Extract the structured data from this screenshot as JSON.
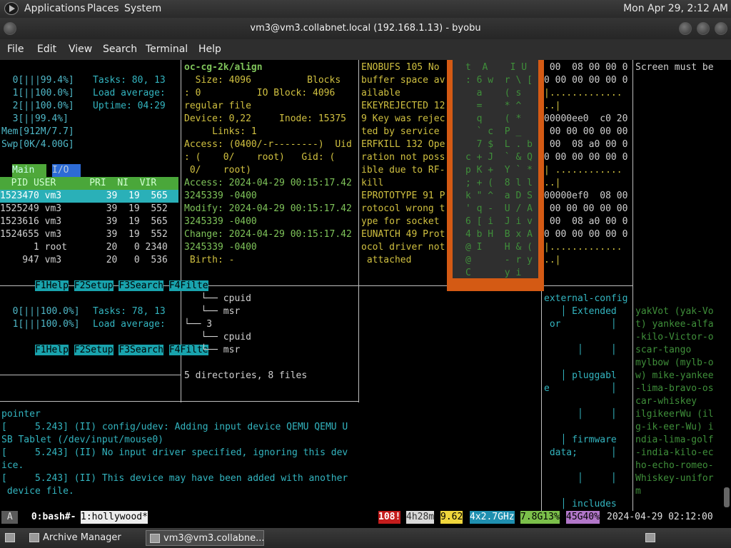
{
  "top_panel": {
    "menus": [
      "Applications",
      "Places",
      "System"
    ],
    "clock": "Mon Apr 29,  2:12 AM"
  },
  "window": {
    "title": "vm3@vm3.collabnet.local (192.168.1.13) - byobu"
  },
  "menubar": [
    "File",
    "Edit",
    "View",
    "Search",
    "Terminal",
    "Help"
  ],
  "htop_top": {
    "cpu_lines": [
      "  0[|||99.4%]",
      "  1[||100.0%]",
      "  2[||100.0%]",
      "  3[||99.4%]",
      "Mem[912M/7.7]",
      "Swp[0K/4.00G]"
    ],
    "tasks": "Tasks: 80, 13",
    "load": "Load average:",
    "uptime": "Uptime: 04:29",
    "tabs": [
      "Main",
      "I/O"
    ],
    "header": "  PID USER      PRI  NI  VIR",
    "rows": [
      "1523470 vm3        39  19  565",
      "1525249 vm3        39  19  552",
      "1523616 vm3        39  19  565",
      "1524655 vm3        39  19  552",
      "      1 root       20   0 2340",
      "    947 vm3        20   0  536"
    ],
    "fkeys": [
      "F1Help",
      "F2Setup",
      "F3Search",
      "F4Filte"
    ]
  },
  "htop_bottom": {
    "cpu_lines": [
      "  0[|||100.0%]",
      "  1[|||100.0%]"
    ],
    "tasks": "Tasks: 78, 13",
    "load": "Load average:",
    "fkeys": [
      "F1Help",
      "F2Setup",
      "F3Search",
      "F4Filte"
    ]
  },
  "stat": {
    "lines": [
      "oc-cg-2k/align",
      "  Size: 4096          Blocks",
      ": 0          IO Block: 4096",
      "regular file",
      "Device: 0,22     Inode: 15375",
      "     Links: 1",
      "Access: (0400/-r--------)  Uid",
      ": (    0/    root)   Gid: (",
      " 0/    root)",
      "Access: 2024-04-29 00:15:17.42",
      "3245339 -0400",
      "Modify: 2024-04-29 00:15:17.42",
      "3245339 -0400",
      "Change: 2024-04-29 00:15:17.42",
      "3245339 -0400",
      " Birth: -"
    ]
  },
  "errno": {
    "lines": [
      "ENOBUFS 105 No",
      "buffer space av",
      "ailable",
      "EKEYREJECTED 12",
      "9 Key was rejec",
      "ted by service",
      "ERFKILL 132 Ope",
      "ration not poss",
      "ible due to RF-",
      "kill",
      "EPROTOTYPE 91 P",
      "rotocol wrong t",
      "ype for socket",
      "EUNATCH 49 Prot",
      "ocol driver not",
      " attached"
    ]
  },
  "popup": {
    "lines": [
      "t  A    I U",
      ": 6 w  r \\ [",
      "  a    ( s",
      "  =    * ^",
      "  q    ( *",
      "  ` c  P _",
      "  7 $  L . b",
      "c + J  ` & Q",
      "p K +  Y ` *",
      "; + (  8 l l",
      "k \" ^  a D S",
      "' q -  U / A",
      "6 [ i  J i v",
      "4 b H  B x A",
      "@ I    H & (",
      "@      - r y",
      "C      y i"
    ]
  },
  "hexdump": {
    "lines": [
      " 00  08 00 00 0",
      "0 00 00 00 00 0",
      "|.............",
      "..|",
      "00000ee0  c0 20",
      " 00 00 00 00 00",
      " 00  08 a0 00 0",
      "0 00 00 00 00 0",
      "| ............",
      "..|",
      "00000ef0  08 00",
      " 00 00 00 00 00",
      " 00  08 a0 00 0",
      "0 00 00 00 00 0",
      "|.............",
      "..|"
    ]
  },
  "screen_msg": "Screen must be",
  "tree": {
    "lines": [
      "   └── cpuid",
      "   └── msr",
      "└── 3",
      "   └── cpuid",
      "   └── msr"
    ],
    "summary": "5 directories, 8 files"
  },
  "dmesg": {
    "lines": [
      "pointer",
      "[     5.243] (II) config/udev: Adding input device QEMU QEMU U",
      "SB Tablet (/dev/input/mouse0)",
      "[     5.243] (II) No input driver specified, ignoring this dev",
      "ice.",
      "[     5.243] (II) This device may have been added with another",
      " device file."
    ]
  },
  "pkgtree": {
    "lines": [
      "external-config",
      "   │ Extended",
      " or         │",
      "",
      "      │     │",
      "",
      "   │ pluggabl",
      "e           │",
      "",
      "      │     │",
      "",
      "   │ firmware",
      " data;      │",
      "",
      "      │     │",
      "",
      "   │ includes"
    ]
  },
  "hollywood_text": {
    "lines": [
      "yakVot (yak-Vo",
      "t) yankee-alfa",
      "-kilo-Victor-o",
      "scar-tango",
      "mylbow (mylb-o",
      "w) mike-yankee",
      "-lima-bravo-os",
      "car-whiskey",
      "ilgikeerWu (il",
      "g-ik-eer-Wu) i",
      "ndia-lima-golf",
      "-india-kilo-ec",
      "ho-echo-romeo-",
      "Whiskey-unifor",
      "m"
    ]
  },
  "status": {
    "a": " A ",
    "win0": " 0:bash#- ",
    "win1": "1:hollywood*",
    "alert": "108!",
    "uptime": "4h28m",
    "load": "9.62",
    "cpu": "4x2.7GHz",
    "mem": "7.8G13%",
    "disk": "45G40%",
    "datetime": "2024-04-29 02:12:00"
  },
  "taskbar": {
    "tasks": [
      "Archive Manager",
      "vm3@vm3.collabne..."
    ]
  }
}
